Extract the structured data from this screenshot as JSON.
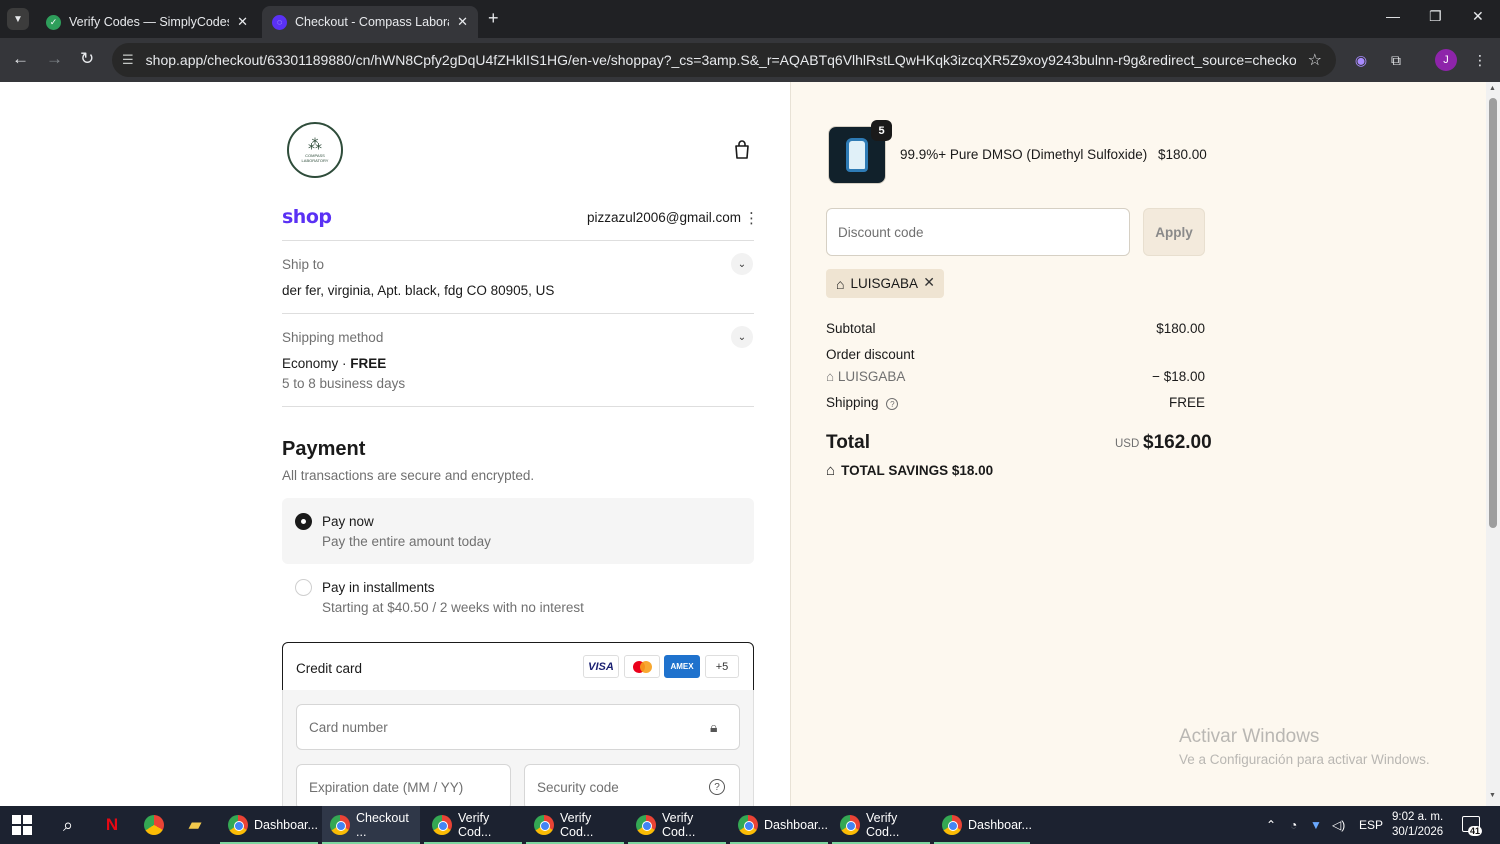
{
  "browser": {
    "tabs": [
      {
        "title": "Verify Codes — SimplyCodes",
        "active": false,
        "favicon_color": "#2e9e5b"
      },
      {
        "title": "Checkout - Compass Laborator",
        "active": true,
        "favicon_color": "#5a31f4"
      }
    ],
    "url": "shop.app/checkout/63301189880/cn/hWN8Cpfy2gDqU4fZHklIS1HG/en-ve/shoppay?_cs=3amp.S&_r=AQABTq6VlhlRstLQwHKqk3izcqXR5Z9xoy9243bulnn-r9g&redirect_source=checkout_automatic...",
    "profile_initial": "J"
  },
  "header": {
    "logo_text": "COMPASS LABORATORY",
    "shop_wordmark": "shop",
    "email": "pizzazul2006@gmail.com"
  },
  "ship_to": {
    "label": "Ship to",
    "address": "der fer, virginia, Apt. black, fdg CO 80905, US"
  },
  "shipping_method": {
    "label": "Shipping method",
    "name": "Economy · ",
    "price": "FREE",
    "eta": "5 to 8 business days"
  },
  "payment": {
    "title": "Payment",
    "subtitle": "All transactions are secure and encrypted.",
    "options": [
      {
        "title": "Pay now",
        "desc": "Pay the entire amount today",
        "selected": true
      },
      {
        "title": "Pay in installments",
        "desc": "Starting at $40.50 / 2 weeks with no interest",
        "selected": false
      }
    ],
    "method_label": "Credit card",
    "card_brands": [
      "VISA",
      "",
      "AMEX",
      "+5"
    ],
    "card_number_placeholder": "Card number",
    "expiry_placeholder": "Expiration date (MM / YY)",
    "security_placeholder": "Security code"
  },
  "summary": {
    "product": {
      "quantity": "5",
      "name": "99.9%+ Pure DMSO (Dimethyl Sulfoxide)",
      "price": "$180.00"
    },
    "discount_placeholder": "Discount code",
    "apply_label": "Apply",
    "applied_code": "LUISGABA",
    "subtotal_label": "Subtotal",
    "subtotal": "$180.00",
    "order_discount_label": "Order discount",
    "discount_code": "LUISGABA",
    "discount_amount": "− $18.00",
    "shipping_label": "Shipping",
    "shipping_value": "FREE",
    "total_label": "Total",
    "currency": "USD",
    "total": "$162.00",
    "savings_label": "TOTAL SAVINGS",
    "savings": "$18.00"
  },
  "watermark": {
    "line1": "Activar Windows",
    "line2": "Ve a Configuración para activar Windows."
  },
  "taskbar": {
    "tasks": [
      {
        "label": "Dashboar...",
        "active": false
      },
      {
        "label": "Checkout ...",
        "active": true
      },
      {
        "label": "Verify Cod...",
        "active": false
      },
      {
        "label": "Verify Cod...",
        "active": false
      },
      {
        "label": "Verify Cod...",
        "active": false
      },
      {
        "label": "Dashboar...",
        "active": false
      },
      {
        "label": "Verify Cod...",
        "active": false
      },
      {
        "label": "Dashboar...",
        "active": false
      }
    ],
    "language": "ESP",
    "time": "9:02 a. m.",
    "date": "30/1/2026",
    "notifications": "41"
  }
}
